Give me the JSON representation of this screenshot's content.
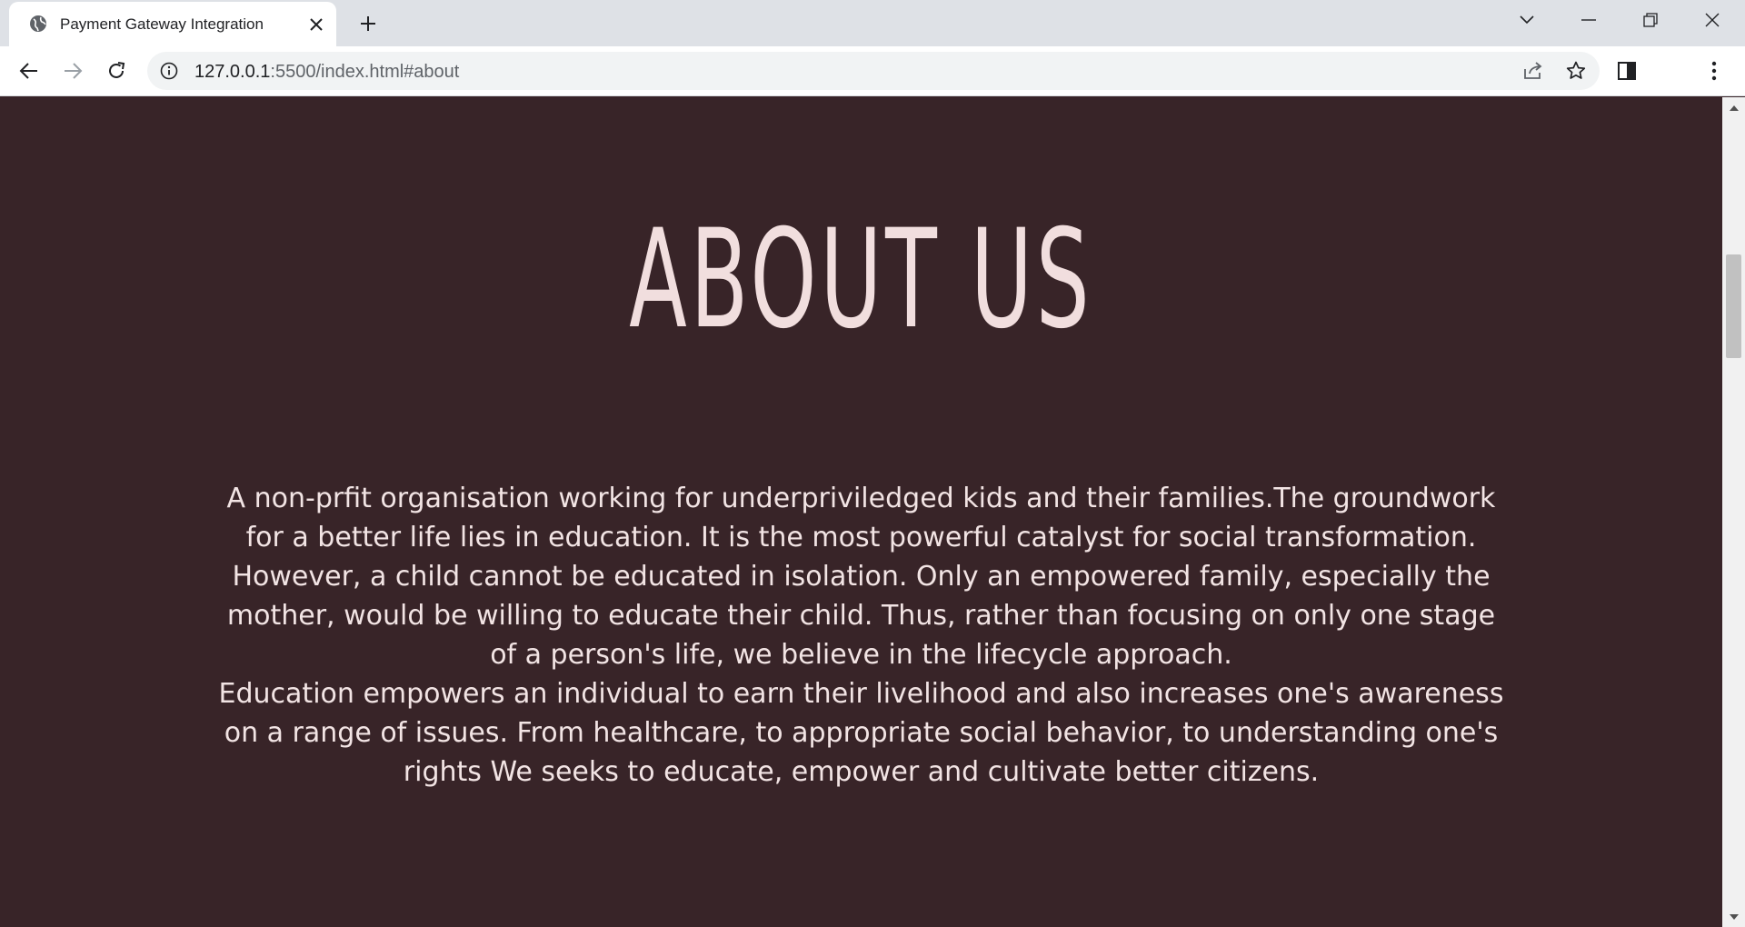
{
  "browser": {
    "tab": {
      "title": "Payment Gateway Integration",
      "favicon": "globe-icon"
    },
    "address_bar": {
      "host": "127.0.0.1",
      "path": ":5500/index.html#about"
    },
    "icons": {
      "back": "arrow-left-icon",
      "forward": "arrow-right-icon",
      "reload": "reload-icon",
      "info": "info-icon",
      "share": "share-icon",
      "bookmark": "star-icon",
      "side_panel": "side-panel-icon",
      "menu": "kebab-menu-icon"
    }
  },
  "colors": {
    "page_bg": "#382428",
    "heading": "#f1dede",
    "body_text": "#f2e4e4"
  },
  "about": {
    "heading": "ABOUT US",
    "paragraph_1": "A non-prfit organisation working for underpriviledged kids and their families.The groundwork for a better life lies in education. It is the most powerful catalyst for social transformation. However, a child cannot be educated in isolation. Only an empowered family, especially the mother, would be willing to educate their child. Thus, rather than focusing on only one stage of a person's life, we believe in the lifecycle approach.",
    "paragraph_2": "Education empowers an individual to earn their livelihood and also increases one's awareness on a range of issues. From healthcare, to appropriate social behavior, to understanding one's rights We seeks to educate, empower and cultivate better citizens."
  }
}
